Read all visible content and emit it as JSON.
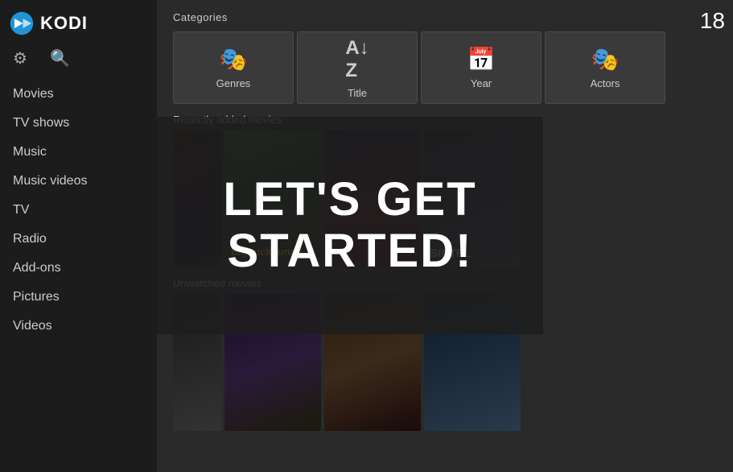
{
  "clock": "18",
  "logo": {
    "text": "KODI"
  },
  "sidebar": {
    "icons": {
      "settings": "⚙",
      "search": "🔍"
    },
    "nav_items": [
      {
        "id": "movies",
        "label": "Movies"
      },
      {
        "id": "tv-shows",
        "label": "TV shows"
      },
      {
        "id": "music",
        "label": "Music"
      },
      {
        "id": "music-videos",
        "label": "Music videos"
      },
      {
        "id": "tv",
        "label": "TV"
      },
      {
        "id": "radio",
        "label": "Radio"
      },
      {
        "id": "add-ons",
        "label": "Add-ons"
      },
      {
        "id": "pictures",
        "label": "Pictures"
      },
      {
        "id": "videos",
        "label": "Videos"
      }
    ]
  },
  "main": {
    "categories_title": "Categories",
    "categories": [
      {
        "id": "genres",
        "label": "Genres",
        "icon": "🎭"
      },
      {
        "id": "title",
        "label": "Title",
        "icon": "🔤"
      },
      {
        "id": "year",
        "label": "Year",
        "icon": "📅"
      },
      {
        "id": "actors",
        "label": "Actors",
        "icon": "🎭"
      }
    ],
    "recently_added_title": "Recently added movies",
    "unwatched_title": "Unwatched movies",
    "modal_text_line1": "LET'S GET",
    "modal_text_line2": "STARTED!"
  }
}
